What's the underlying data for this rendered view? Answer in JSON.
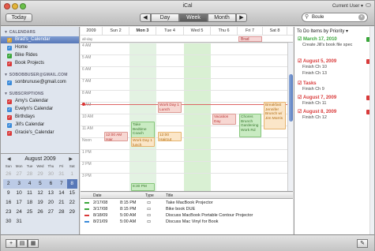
{
  "window": {
    "title": "iCal",
    "current_user": "Current User ▾"
  },
  "toolbar": {
    "today_label": "Today",
    "prev_label": "◀",
    "next_label": "▶",
    "views": [
      "Day",
      "Week",
      "Month"
    ],
    "active_view": "Week",
    "search_value": "Boule",
    "search_icon": "magnifier-icon"
  },
  "sidebar": {
    "calendars_header": "▼ CALENDARS",
    "calendars": [
      {
        "label": "Brad's_Calendar",
        "color": "#d9a43a",
        "selected": true
      },
      {
        "label": "Home",
        "color": "#3a8ad9"
      },
      {
        "label": "Bike Rides",
        "color": "#3aa63a"
      },
      {
        "label": "Book Projects",
        "color": "#d93a3a"
      }
    ],
    "account_header": "▼ SOBOBBUSER@GMAIL.COM",
    "account_items": [
      {
        "label": "sonbrunuse@gmail.com",
        "color": "#3a8ad9"
      }
    ],
    "subscriptions_header": "▼ SUBSCRIPTIONS",
    "subscriptions": [
      {
        "label": "Amy's Calendar",
        "color": "#d93a3a"
      },
      {
        "label": "Evelyn's Calendar",
        "color": "#3a8ad9"
      },
      {
        "label": "Birthdays",
        "color": "#d93a3a"
      },
      {
        "label": "Jill's Calendar",
        "color": "#3a8ad9"
      },
      {
        "label": "Gracie's_Calendar",
        "color": "#d93a3a"
      }
    ]
  },
  "minical": {
    "title": "August 2009",
    "prev": "◀",
    "next": "▶",
    "dows": [
      "Sun",
      "Mon",
      "Tue",
      "Wed",
      "Thu",
      "Fri",
      "Sat"
    ],
    "weeks": [
      [
        "26",
        "27",
        "28",
        "29",
        "30",
        "31",
        "1"
      ],
      [
        "2",
        "3",
        "4",
        "5",
        "6",
        "7",
        "8"
      ],
      [
        "9",
        "10",
        "11",
        "12",
        "13",
        "14",
        "15"
      ],
      [
        "16",
        "17",
        "18",
        "19",
        "20",
        "21",
        "22"
      ],
      [
        "23",
        "24",
        "25",
        "26",
        "27",
        "28",
        "29"
      ],
      [
        "30",
        "31",
        "",
        "",
        "",
        "",
        ""
      ]
    ]
  },
  "week": {
    "days": [
      "2009",
      "Sun 2",
      "Mon 3",
      "Tue 4",
      "Wed 5",
      "Thu 6",
      "Fri 7",
      "Sat 8"
    ],
    "allday_label": "all-day",
    "allday_event": "Brad Adams",
    "hours": [
      "4 AM",
      "5 AM",
      "6 AM",
      "7 AM",
      "8 AM",
      "9 AM",
      "10 AM",
      "11 AM",
      "Noon",
      "1 PM",
      "2 PM",
      "3 PM"
    ],
    "events": [
      {
        "label": "Work Day 1 Lunch",
        "color": "red"
      },
      {
        "label": "Take Bedtime Coach",
        "color": "green"
      },
      {
        "label": "12:00 AM Hair",
        "color": "red"
      },
      {
        "label": "12:00 Haircut",
        "color": "orange"
      },
      {
        "label": "Work Day 1 lunch",
        "color": "orange"
      },
      {
        "label": "Vacation Day",
        "color": "red"
      },
      {
        "label": "Chores Brunch Gardening Work Rd",
        "color": "green"
      },
      {
        "label": "Breakfast Jennifer Brunch w/ Jim Morris",
        "color": "orange"
      },
      {
        "label": "8:30 PM",
        "color": "green"
      }
    ]
  },
  "todo": {
    "header": "To Do Items by Priority ▾",
    "groups": [
      {
        "date": "March 17, 2010",
        "color": "#3aa63a",
        "items": [
          "Create Jill's book file spec"
        ]
      },
      {
        "date": "August 5, 2009",
        "color": "#d93a3a",
        "items": [
          "Finish Ch 10",
          "Finish Ch 13"
        ]
      },
      {
        "date": "Tasks",
        "color": "#d93a3a",
        "items": [
          "Finish Ch 9"
        ]
      },
      {
        "date": "August 7, 2009",
        "color": "#d93a3a",
        "items": [
          "Finish Ch 11"
        ]
      },
      {
        "date": "August 8, 2009",
        "color": "#d93a3a",
        "items": [
          "Finish Ch 12"
        ]
      }
    ]
  },
  "list": {
    "headers": [
      "Date",
      "Type",
      "Title"
    ],
    "rows": [
      {
        "date": "2/17/08",
        "time": "8:15 PM",
        "type": "▭",
        "title": "Take MacBook Projector",
        "color": "#3aa63a"
      },
      {
        "date": "3/17/08",
        "time": "8:15 PM",
        "type": "▭",
        "title": "Bike book DUE",
        "color": "#3aa63a"
      },
      {
        "date": "8/18/09",
        "time": "5:00 AM",
        "type": "▭",
        "title": "Discuss MacBook Portable Contour Projector",
        "color": "#d93a3a"
      },
      {
        "date": "8/21/09",
        "time": "5:00 AM",
        "type": "▭",
        "title": "Discuss Mac Vinyl for Book",
        "color": "#3a8ad9"
      }
    ]
  },
  "bottom": {
    "add_label": "+",
    "show_label": "▤",
    "grid_label": "▦",
    "notification_label": "✎"
  }
}
